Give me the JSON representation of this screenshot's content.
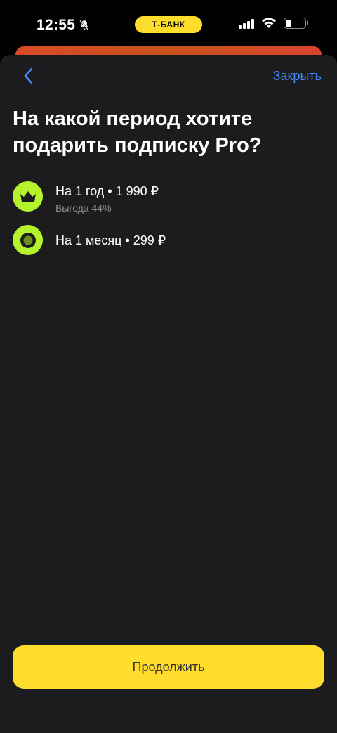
{
  "status_bar": {
    "time": "12:55",
    "badge": "Т-БАНК",
    "icons": [
      "bell-off-icon",
      "signal-icon",
      "wifi-icon",
      "battery-icon"
    ]
  },
  "header": {
    "back_icon": "chevron-left-icon",
    "close_label": "Закрыть"
  },
  "title": "На какой период хотите подарить подписку Pro?",
  "options": [
    {
      "title": "На 1 год • 1 990 ₽",
      "subtitle": "Выгода 44%",
      "icon": "crown-icon"
    },
    {
      "title": "На 1 месяц • 299 ₽",
      "subtitle": "",
      "icon": "circle-icon"
    }
  ],
  "continue_label": "Продолжить",
  "colors": {
    "accent_yellow": "#ffdd2d",
    "pro_green": "#b5f42d",
    "link_blue": "#428bf9",
    "sheet_bg": "#1c1c1e"
  }
}
